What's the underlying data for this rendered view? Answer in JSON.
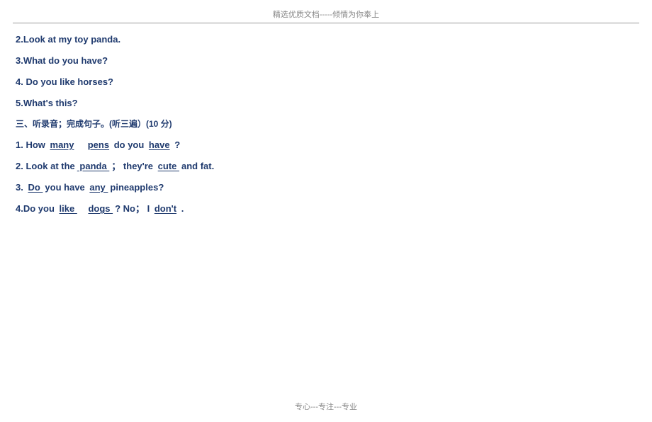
{
  "header": "精选优质文档-----倾情为你奉上",
  "footer": "专心---专注---专业",
  "lines": {
    "l2": "2.Look at my toy panda.",
    "l3": "3.What do you have?",
    "l4": "4. Do you like horses?",
    "l5": "5.What's this?"
  },
  "section3_title": "三、听录音；完成句子。(听三遍）(10 分)",
  "q1": {
    "pre": "1. How ",
    "b1": "many",
    "b2": "pens",
    "mid": " do you ",
    "b3": "have",
    "end": " ?"
  },
  "q2": {
    "pre": "2. Look at the",
    "b1": " panda ",
    "mid1": "；  they're ",
    "b2": " cute ",
    "end": " and fat."
  },
  "q3": {
    "pre": "3. ",
    "b1": " Do ",
    "mid1": " you have ",
    "b2": " any ",
    "end": " pineapples?"
  },
  "q4": {
    "pre": "4.Do you ",
    "b1": " like ",
    "b2": " dogs ",
    "mid": " ? No； I ",
    "b3": "don't",
    "end": " ."
  }
}
